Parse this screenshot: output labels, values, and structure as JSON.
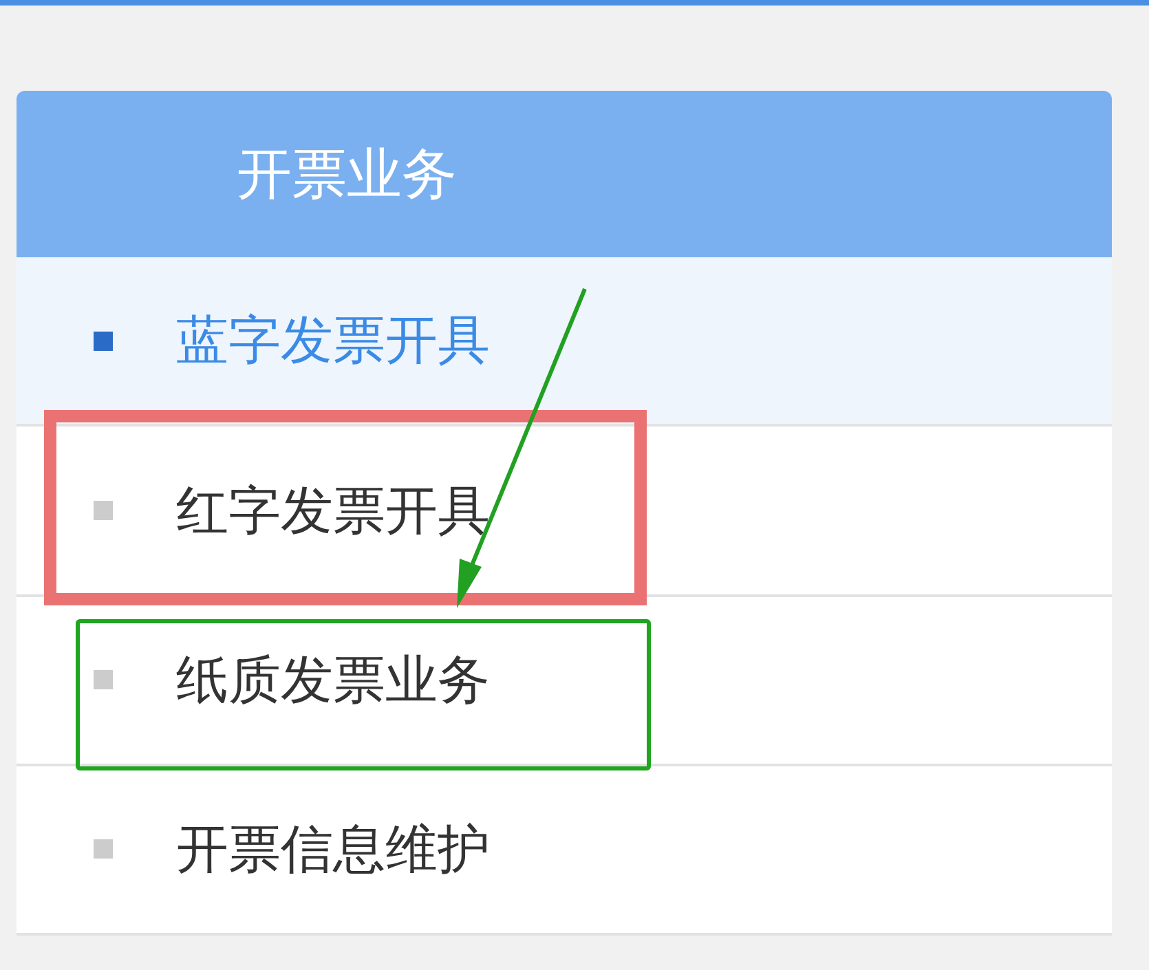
{
  "panel": {
    "title": "开票业务"
  },
  "menu": [
    {
      "label": "蓝字发票开具",
      "selected": true
    },
    {
      "label": "红字发票开具",
      "selected": false,
      "frame": {
        "kind": "brush",
        "color": "#eb7272"
      }
    },
    {
      "label": "纸质发票业务",
      "selected": false,
      "frame": {
        "kind": "line",
        "color": "#1fa51f"
      }
    },
    {
      "label": "开票信息维护",
      "selected": false
    }
  ],
  "arrow": {
    "color": "#22a022"
  }
}
